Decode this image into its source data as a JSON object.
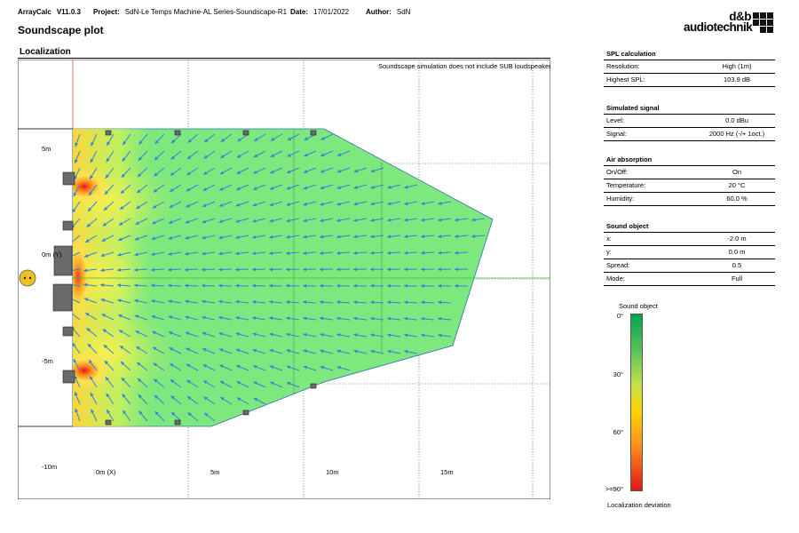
{
  "header": {
    "app_label": "ArrayCalc",
    "app_version": "V11.0.3",
    "project_label": "Project:",
    "project_value": "SdN-Le Temps Machine-AL Series-Soundscape-R1",
    "date_label": "Date:",
    "date_value": "17/01/2022",
    "author_label": "Author:",
    "author_value": "SdN"
  },
  "brand": {
    "line1": "d&b",
    "line2": "audiotechnik"
  },
  "page_title": "Soundscape plot",
  "section_title": "Localization",
  "plot": {
    "note": "Soundscape simulation does not include SUB loudspeakers.",
    "y_labels": [
      "5m",
      "0m (Y)",
      "-5m",
      "-10m"
    ],
    "x_labels": [
      "0m (X)",
      "5m",
      "10m",
      "15m"
    ],
    "field_color": "#7ee87e",
    "source_colors": [
      "#ffe14d",
      "#ff8a1a",
      "#e81818"
    ]
  },
  "panels": {
    "spl": {
      "title": "SPL calculation",
      "rows": [
        {
          "label": "Resolution:",
          "value": "High (1m)"
        },
        {
          "label": "Highest SPL:",
          "value": "103.9 dB"
        }
      ]
    },
    "signal": {
      "title": "Simulated signal",
      "rows": [
        {
          "label": "Level:",
          "value": "0.0 dBu"
        },
        {
          "label": "Signal:",
          "value": "2000 Hz (-/+ 1oct.)"
        }
      ]
    },
    "air": {
      "title": "Air absorption",
      "rows": [
        {
          "label": "On/Off:",
          "value": "On"
        },
        {
          "label": "Temperature:",
          "value": "20 °C"
        },
        {
          "label": "Humidity:",
          "value": "60.0 %"
        }
      ]
    },
    "sound_object": {
      "title": "Sound object",
      "rows": [
        {
          "label": "x:",
          "value": "-2.0 m"
        },
        {
          "label": "y:",
          "value": "0.0 m"
        },
        {
          "label": "Spread:",
          "value": "0.5"
        },
        {
          "label": "Mode:",
          "value": "Full"
        }
      ]
    }
  },
  "legend": {
    "title": "Sound object",
    "ticks": [
      "0°",
      "30°",
      "60°",
      ">=90°"
    ],
    "footer": "Localization deviation"
  }
}
